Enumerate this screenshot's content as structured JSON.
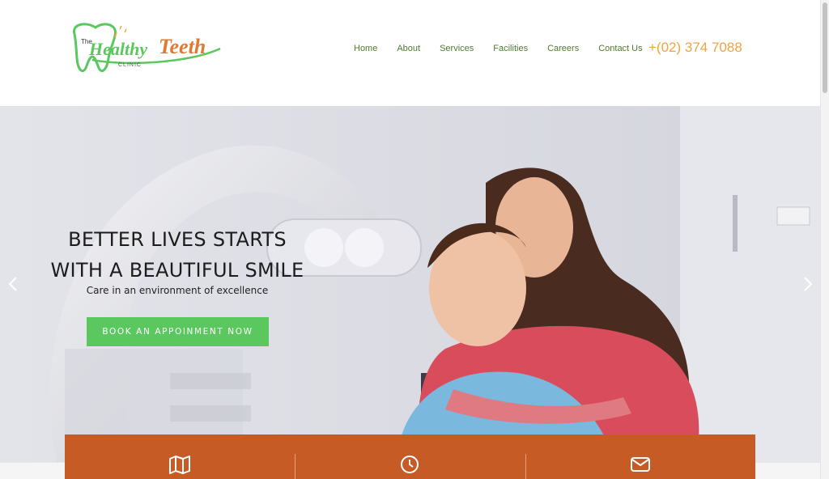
{
  "brand": {
    "logo": {
      "the": "The",
      "healthy": "Healthy",
      "teeth": "Teeth",
      "clinic": "CLINIC"
    },
    "colors": {
      "green": "#5ac85e",
      "orange": "#f0a440",
      "nav_green": "#4f7a2e",
      "bar_orange": "#c65b25"
    }
  },
  "nav": {
    "items": [
      {
        "label": "Home"
      },
      {
        "label": "About"
      },
      {
        "label": "Services"
      },
      {
        "label": "Facilities"
      },
      {
        "label": "Careers"
      },
      {
        "label": "Contact Us"
      }
    ],
    "phone": "+(02) 374 7088"
  },
  "hero": {
    "title_line1": "BETTER LIVES STARTS",
    "title_line2": "WITH A BEAUTIFUL SMILE",
    "subtitle": "Care in an environment of excellence",
    "cta_label": "BOOK AN APPOINMENT NOW",
    "prev_icon": "chevron-left-icon",
    "next_icon": "chevron-right-icon"
  },
  "info_bar": {
    "icons": [
      "map-icon",
      "clock-icon",
      "envelope-icon"
    ]
  }
}
